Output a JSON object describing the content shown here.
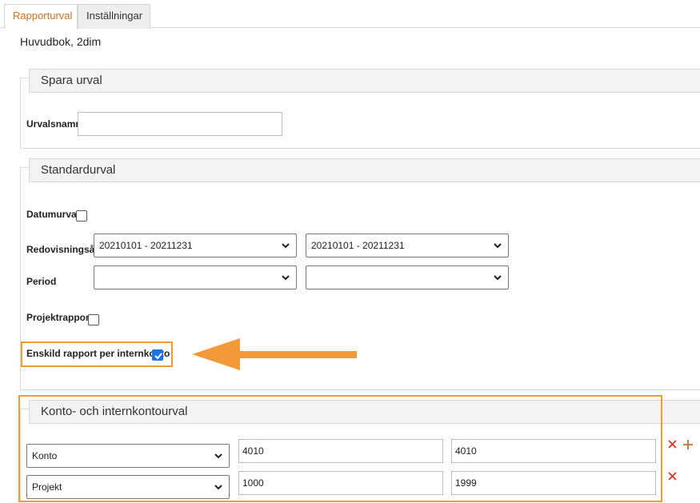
{
  "tabs": [
    {
      "label": "Rapporturval",
      "active": true
    },
    {
      "label": "Inställningar",
      "active": false
    }
  ],
  "page_title": "Huvudbok, 2dim",
  "spara_urval": {
    "heading": "Spara urval",
    "urvalsnamn_label": "Urvalsnamn",
    "urvalsnamn_value": ""
  },
  "standardurval": {
    "heading": "Standardurval",
    "datumurval_label": "Datumurval",
    "datumurval_checked": false,
    "redovisningsar_label": "Redovisningsår",
    "redovisningsar_from": "20210101 - 20211231",
    "redovisningsar_to": "20210101 - 20211231",
    "period_label": "Period",
    "period_from": "",
    "period_to": "",
    "projektrapport_label": "Projektrapport",
    "projektrapport_checked": false,
    "enskild_label": "Enskild rapport per internkonto",
    "enskild_checked": true
  },
  "konto_internkonto": {
    "heading": "Konto- och internkontourval",
    "rows": [
      {
        "type": "Konto",
        "from": "4010",
        "to": "4010"
      },
      {
        "type": "Projekt",
        "from": "1000",
        "to": "1999"
      }
    ]
  },
  "colors": {
    "accent": "#c8742a",
    "highlight": "#f29a38",
    "delete": "#d9342b",
    "checkbox": "#1a73e8"
  },
  "icons": [
    "chevron-down-icon",
    "delete-icon",
    "add-icon",
    "arrow-left-icon",
    "checkmark-icon"
  ]
}
